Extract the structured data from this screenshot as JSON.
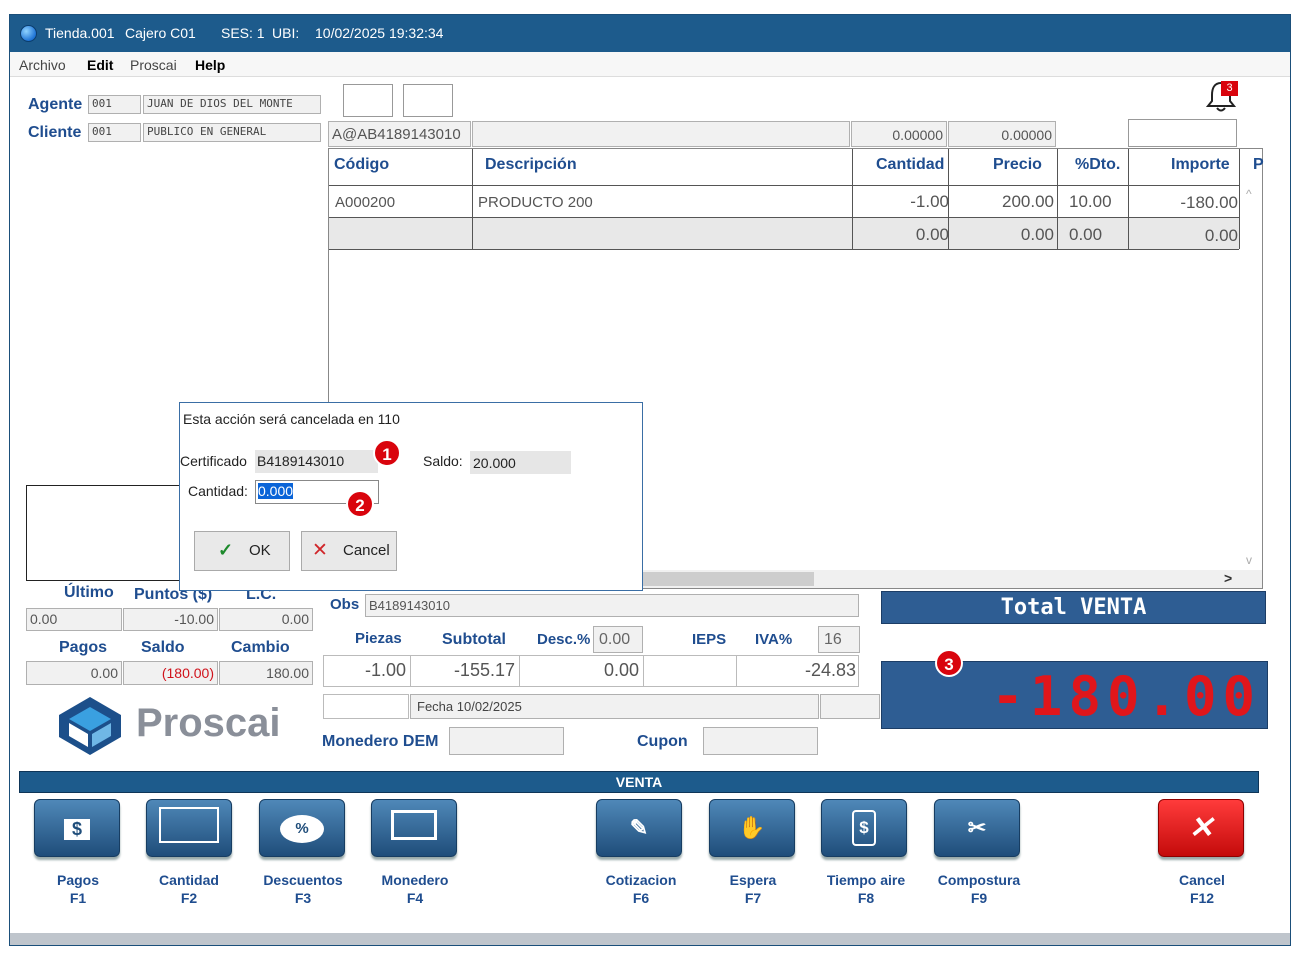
{
  "titlebar": {
    "tienda": "Tienda.001",
    "cajero": "Cajero C01",
    "ses": "SES: 1",
    "ubi": "UBI:",
    "datetime": "10/02/2025 19:32:34"
  },
  "menu": [
    "Archivo",
    "Edit",
    "Proscai",
    "Help"
  ],
  "agente": {
    "label": "Agente",
    "code": "001",
    "name": "JUAN DE DIOS DEL MONTE"
  },
  "cliente": {
    "label": "Cliente",
    "code": "001",
    "name": "PUBLICO EN GENERAL"
  },
  "notifications": {
    "count": "3"
  },
  "scan": {
    "code": "A@AB4189143010",
    "val1": "0.00000",
    "val2": "0.00000"
  },
  "table": {
    "headers": [
      "Código",
      "Descripción",
      "Cantidad",
      "Precio",
      "%Dto.",
      "Importe",
      "P"
    ],
    "rows": [
      [
        "A000200",
        "PRODUCTO 200",
        "-1.00",
        "200.00",
        "10.00",
        "-180.00"
      ],
      [
        "",
        "",
        "0.00",
        "0.00",
        "0.00",
        "0.00"
      ]
    ]
  },
  "dialog": {
    "message": "Esta acción será cancelada en 110",
    "cert_label": "Certificado",
    "cert_value": "B4189143010",
    "saldo_label": "Saldo:",
    "saldo_value": "20.000",
    "cantidad_label": "Cantidad:",
    "cantidad_value": "0.000",
    "ok": "OK",
    "cancel": "Cancel"
  },
  "annotations": [
    "1",
    "2",
    "3"
  ],
  "summary_left": {
    "ultimo_label": "Último",
    "puntos_label": "Puntos ($)",
    "lc_label": "L.C.",
    "ultimo": "0.00",
    "puntos": "-10.00",
    "lc": "0.00",
    "pagos_label": "Pagos",
    "saldo_label": "Saldo",
    "cambio_label": "Cambio",
    "pagos": "0.00",
    "saldo": "(180.00)",
    "cambio": "180.00"
  },
  "logo_text": "Proscai",
  "obs": {
    "label": "Obs",
    "value": "B4189143010"
  },
  "totals": {
    "piezas_label": "Piezas",
    "subtotal_label": "Subtotal",
    "desc_label": "Desc.%",
    "desc_pct": "0.00",
    "ieps_label": "IEPS",
    "iva_label": "IVA%",
    "iva_pct": "16",
    "piezas": "-1.00",
    "subtotal": "-155.17",
    "desc": "0.00",
    "iva": "-24.83"
  },
  "fecha": "Fecha 10/02/2025",
  "monedero_label": "Monedero DEM",
  "cupon_label": "Cupon",
  "total_venta": {
    "label": "Total VENTA",
    "amount": "-180.00"
  },
  "section_label": "VENTA",
  "fkeys": [
    {
      "label": "Pagos",
      "key": "F1",
      "icon": "dollar-bill-icon"
    },
    {
      "label": "Cantidad",
      "key": "F2",
      "icon": "calculator-icon"
    },
    {
      "label": "Descuentos",
      "key": "F3",
      "icon": "percent-icon"
    },
    {
      "label": "Monedero",
      "key": "F4",
      "icon": "card-icon"
    },
    {
      "label": "Cotizacion",
      "key": "F6",
      "icon": "edit-note-icon"
    },
    {
      "label": "Espera",
      "key": "F7",
      "icon": "hand-stop-icon"
    },
    {
      "label": "Tiempo aire",
      "key": "F8",
      "icon": "phone-dollar-icon"
    },
    {
      "label": "Compostura",
      "key": "F9",
      "icon": "scissors-icon"
    },
    {
      "label": "Cancel",
      "key": "F12",
      "icon": "close-x-icon"
    }
  ],
  "colors": {
    "titlebar": "#1d5b8c",
    "accent_blue": "#1f4d8f",
    "total_bg": "#2e5d93",
    "led_red": "#e0161b",
    "badge_red": "#d9040d"
  }
}
